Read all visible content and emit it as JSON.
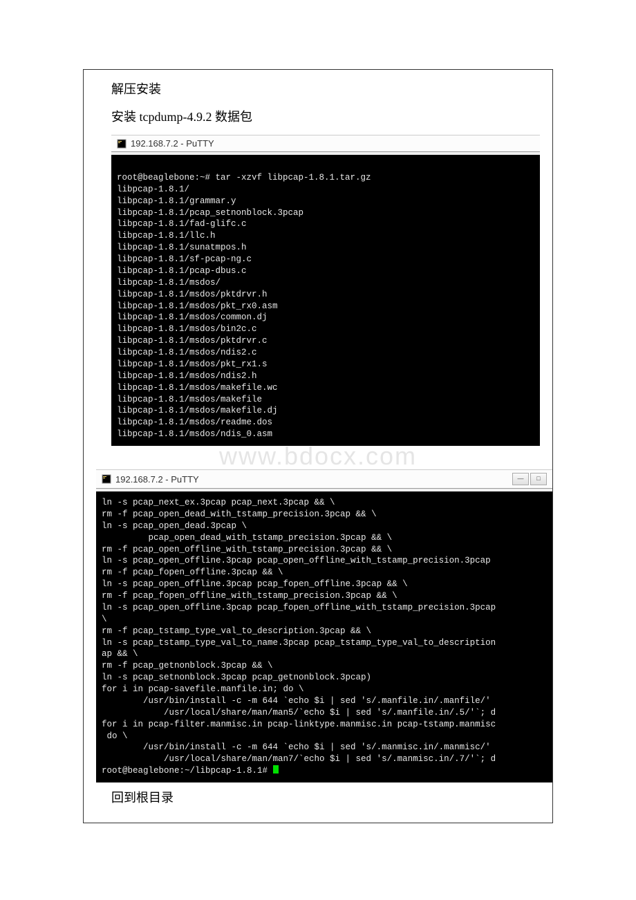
{
  "heading1": "解压安装",
  "heading2": "安装 tcpdump-4.9.2 数据包",
  "footer_text": "回到根目录",
  "watermark_text": "www.bdocx.com",
  "putty1": {
    "title": "192.168.7.2 - PuTTY",
    "lines": [
      "",
      "root@beaglebone:~# tar -xzvf libpcap-1.8.1.tar.gz",
      "libpcap-1.8.1/",
      "libpcap-1.8.1/grammar.y",
      "libpcap-1.8.1/pcap_setnonblock.3pcap",
      "libpcap-1.8.1/fad-glifc.c",
      "libpcap-1.8.1/llc.h",
      "libpcap-1.8.1/sunatmpos.h",
      "libpcap-1.8.1/sf-pcap-ng.c",
      "libpcap-1.8.1/pcap-dbus.c",
      "libpcap-1.8.1/msdos/",
      "libpcap-1.8.1/msdos/pktdrvr.h",
      "libpcap-1.8.1/msdos/pkt_rx0.asm",
      "libpcap-1.8.1/msdos/common.dj",
      "libpcap-1.8.1/msdos/bin2c.c",
      "libpcap-1.8.1/msdos/pktdrvr.c",
      "libpcap-1.8.1/msdos/ndis2.c",
      "libpcap-1.8.1/msdos/pkt_rx1.s",
      "libpcap-1.8.1/msdos/ndis2.h",
      "libpcap-1.8.1/msdos/makefile.wc",
      "libpcap-1.8.1/msdos/makefile",
      "libpcap-1.8.1/msdos/makefile.dj",
      "libpcap-1.8.1/msdos/readme.dos",
      "libpcap-1.8.1/msdos/ndis_0.asm"
    ]
  },
  "putty2": {
    "title": "192.168.7.2 - PuTTY",
    "lines": [
      "ln -s pcap_next_ex.3pcap pcap_next.3pcap && \\",
      "rm -f pcap_open_dead_with_tstamp_precision.3pcap && \\",
      "ln -s pcap_open_dead.3pcap \\",
      "         pcap_open_dead_with_tstamp_precision.3pcap && \\",
      "rm -f pcap_open_offline_with_tstamp_precision.3pcap && \\",
      "ln -s pcap_open_offline.3pcap pcap_open_offline_with_tstamp_precision.3pcap",
      "rm -f pcap_fopen_offline.3pcap && \\",
      "ln -s pcap_open_offline.3pcap pcap_fopen_offline.3pcap && \\",
      "rm -f pcap_fopen_offline_with_tstamp_precision.3pcap && \\",
      "ln -s pcap_open_offline.3pcap pcap_fopen_offline_with_tstamp_precision.3pcap",
      "\\",
      "rm -f pcap_tstamp_type_val_to_description.3pcap && \\",
      "ln -s pcap_tstamp_type_val_to_name.3pcap pcap_tstamp_type_val_to_description",
      "ap && \\",
      "rm -f pcap_getnonblock.3pcap && \\",
      "ln -s pcap_setnonblock.3pcap pcap_getnonblock.3pcap)",
      "for i in pcap-savefile.manfile.in; do \\",
      "        /usr/bin/install -c -m 644 `echo $i | sed 's/.manfile.in/.manfile/'",
      "            /usr/local/share/man/man5/`echo $i | sed 's/.manfile.in/.5/'`; d",
      "for i in pcap-filter.manmisc.in pcap-linktype.manmisc.in pcap-tstamp.manmisc",
      " do \\",
      "        /usr/bin/install -c -m 644 `echo $i | sed 's/.manmisc.in/.manmisc/'",
      "            /usr/local/share/man/man7/`echo $i | sed 's/.manmisc.in/.7/'`; d"
    ],
    "prompt": "root@beaglebone:~/libpcap-1.8.1# "
  }
}
